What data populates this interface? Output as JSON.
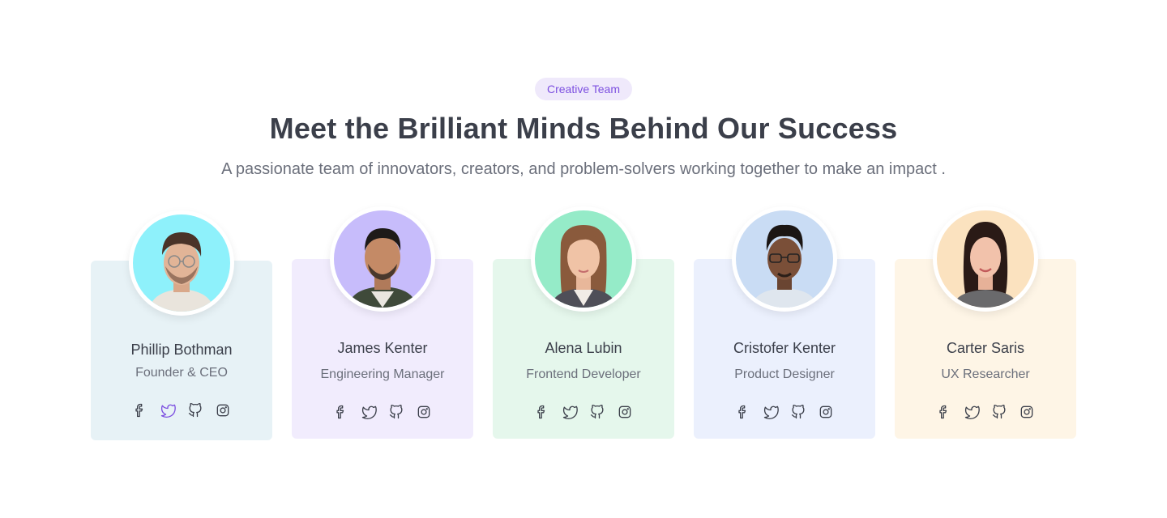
{
  "badge": "Creative Team",
  "title": "Meet the Brilliant Minds Behind Our Success",
  "subtitle": "A passionate team of innovators, creators, and problem-solvers working together to make an impact .",
  "colors": {
    "accent": "#7c4fe0",
    "badge_bg": "#efe9fb",
    "text": "#3b3f4a",
    "muted": "#6b6f7b"
  },
  "members": [
    {
      "name": "Phillip Bothman",
      "role": "Founder & CEO",
      "card_bg": "#e7f2f6",
      "avatar_bg": "#8ef1fb",
      "active_social": "twitter-icon"
    },
    {
      "name": "James Kenter",
      "role": "Engineering Manager",
      "card_bg": "#f1ecfd",
      "avatar_bg": "#c7bcfb",
      "active_social": ""
    },
    {
      "name": "Alena Lubin",
      "role": "Frontend Developer",
      "card_bg": "#e5f7ec",
      "avatar_bg": "#95ebc8",
      "active_social": ""
    },
    {
      "name": "Cristofer Kenter",
      "role": "Product Designer",
      "card_bg": "#ebf0fd",
      "avatar_bg": "#c9dcf4",
      "active_social": ""
    },
    {
      "name": "Carter Saris",
      "role": "UX Researcher",
      "card_bg": "#fef5e6",
      "avatar_bg": "#fbe2bf",
      "active_social": ""
    }
  ],
  "social_icons": [
    "facebook-icon",
    "twitter-icon",
    "github-icon",
    "instagram-icon"
  ]
}
